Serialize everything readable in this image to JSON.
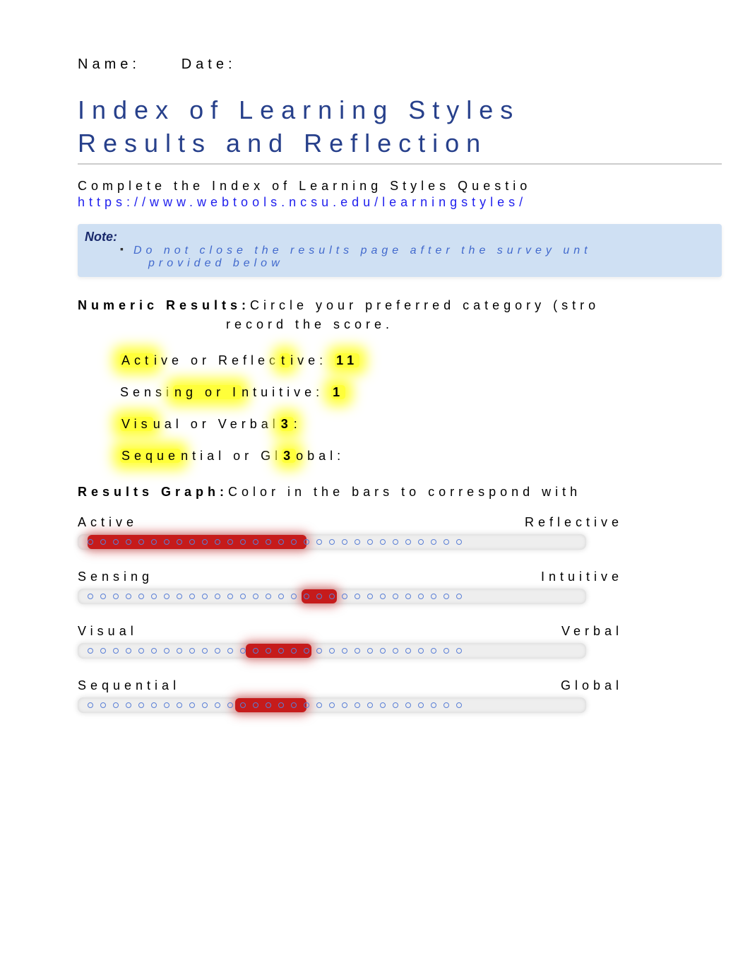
{
  "header": {
    "name_label": "Name:",
    "date_label": "Date:"
  },
  "title_line1": "Index of Learning Styles",
  "title_line2": "Results and Reflection",
  "intro": "Complete the Index of Learning Styles Questio",
  "url": "https://www.webtools.ncsu.edu/learningstyles/",
  "note": {
    "label": "Note:",
    "line1": "Do not close the results page after the survey unt",
    "line2": "provided below"
  },
  "numeric": {
    "heading_bold": "Numeric Results:",
    "heading_rest": "Circle your preferred category (stro",
    "sub": "record the score.",
    "items": [
      {
        "pre_hl": "Act",
        "post": "ive or Reflec",
        "mid_hl": "t",
        "post2": "ive:",
        "score_hl": "11"
      },
      {
        "pre": "Sensi",
        "mid_hl": "ng or I",
        "post": "ntuitive: ",
        "score_hl": "1"
      },
      {
        "pre_hl": "Vis",
        "post": "ual or Verbal",
        "score_hl": "3",
        "post2": ":"
      },
      {
        "pre_hl": "Seque",
        "post": "ntial or Gl",
        "score_hl": "3",
        "post2": "obal:"
      }
    ]
  },
  "graph": {
    "heading_bold": "Results Graph:",
    "heading_rest": "Color in the bars to correspond with ",
    "pairs": [
      {
        "left": "Active",
        "right": "Reflective",
        "fill_left_pct": 2,
        "fill_width_pct": 43
      },
      {
        "left": "Sensing",
        "right": "Intuitive",
        "fill_left_pct": 44,
        "fill_width_pct": 7
      },
      {
        "left": "Visual",
        "right": "Verbal",
        "fill_left_pct": 33,
        "fill_width_pct": 13
      },
      {
        "left": "Sequential",
        "right": "Global",
        "fill_left_pct": 31,
        "fill_width_pct": 14
      }
    ]
  },
  "chart_data": {
    "type": "bar",
    "title": "Index of Learning Styles Results",
    "series": [
      {
        "name": "Active/Reflective",
        "value": 11,
        "direction": "Active"
      },
      {
        "name": "Sensing/Intuitive",
        "value": 1,
        "direction": "Intuitive"
      },
      {
        "name": "Visual/Verbal",
        "value": 3,
        "direction": "Visual"
      },
      {
        "name": "Sequential/Global",
        "value": 3,
        "direction": "Sequential"
      }
    ],
    "scale": [
      -11,
      11
    ]
  }
}
